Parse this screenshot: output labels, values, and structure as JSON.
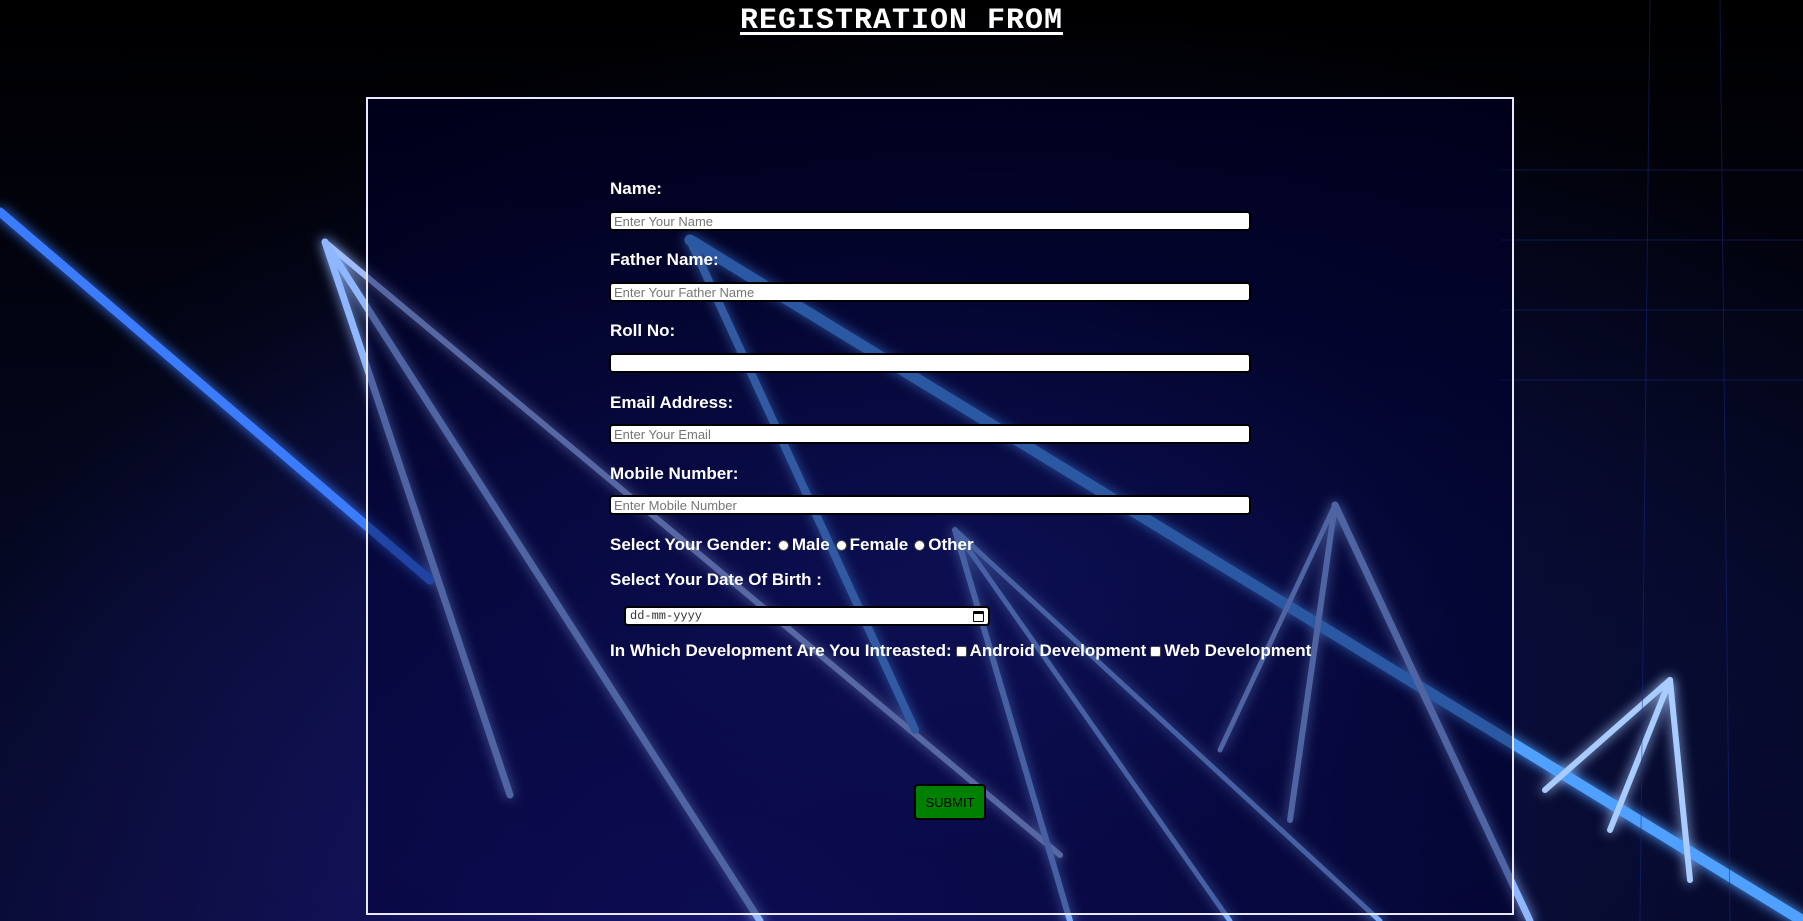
{
  "page": {
    "title": "REGISTRATION FROM"
  },
  "form": {
    "name": {
      "label": "Name:",
      "placeholder": "Enter Your Name",
      "value": ""
    },
    "father_name": {
      "label": "Father Name:",
      "placeholder": "Enter Your Father Name",
      "value": ""
    },
    "roll_no": {
      "label": "Roll No:",
      "placeholder": "",
      "value": ""
    },
    "email": {
      "label": "Email Address:",
      "placeholder": "Enter Your Email",
      "value": ""
    },
    "mobile": {
      "label": "Mobile Number:",
      "placeholder": "Enter Mobile Number",
      "value": ""
    },
    "gender": {
      "label": "Select Your Gender:",
      "options": [
        "Male",
        "Female",
        "Other"
      ],
      "selected": null
    },
    "dob": {
      "label": "Select Your Date Of Birth :",
      "placeholder": "dd-mm-yyyy"
    },
    "development": {
      "label": "In Which Development Are You Intreasted:",
      "options": [
        "Android Development",
        "Web Development"
      ],
      "checked": []
    },
    "submit_label": "SUBMIT"
  },
  "colors": {
    "background": "#000000",
    "panel_border": "#e8e8ff",
    "submit_bg": "#008000",
    "neon_line": "#6fb4ff"
  }
}
